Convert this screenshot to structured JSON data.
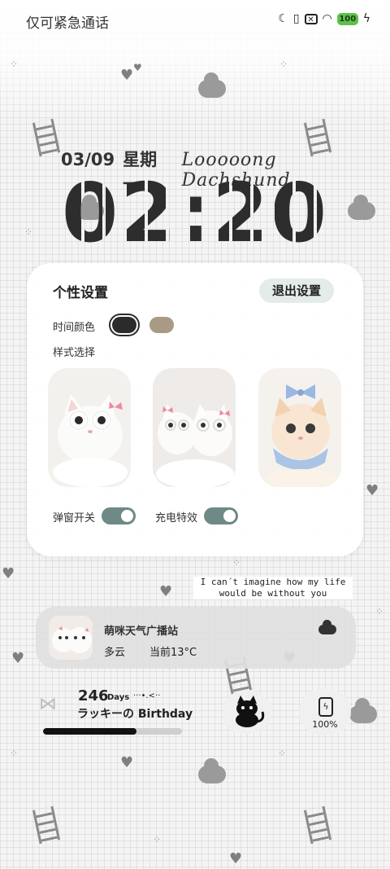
{
  "status_bar": {
    "left_text": "仅可紧急通话",
    "icons": [
      "moon-icon",
      "vibrate-icon",
      "sim-off-icon",
      "wifi-icon"
    ],
    "battery_level": "100"
  },
  "lockscreen": {
    "date": "03/09",
    "weekday": "星期一",
    "signature": "Looooong Dachshund",
    "time": "02:20"
  },
  "settings_panel": {
    "title": "个性设置",
    "exit_label": "退出设置",
    "time_color_label": "时间颜色",
    "colors": [
      "#2b2b2b",
      "#a99a85"
    ],
    "selected_color_index": 0,
    "style_label": "样式选择",
    "styles": [
      "kitten-with-glasses",
      "two-kittens-with-glasses",
      "kitten-with-bow"
    ],
    "popup_toggle_label": "弹窗开关",
    "popup_toggle_on": true,
    "charge_effect_label": "充电特效",
    "charge_effect_on": true
  },
  "quote": {
    "line1": "I can´t imagine how my life",
    "line2": "would be without you"
  },
  "weather": {
    "title": "萌咪天气广播站",
    "condition": "多云",
    "current_temp": "当前13°C",
    "icon": "cloud-icon"
  },
  "birthday": {
    "days_count": "246",
    "days_label": "Days",
    "days_decor": "···•.<··",
    "label": "ラッキーの Birthday",
    "progress_fraction": 0.67
  },
  "charging": {
    "percent": "100%"
  },
  "colors": {
    "accent_toggle": "#6f8a86",
    "exit_button_bg": "#e4ecea",
    "battery_green": "#5cc24a"
  }
}
